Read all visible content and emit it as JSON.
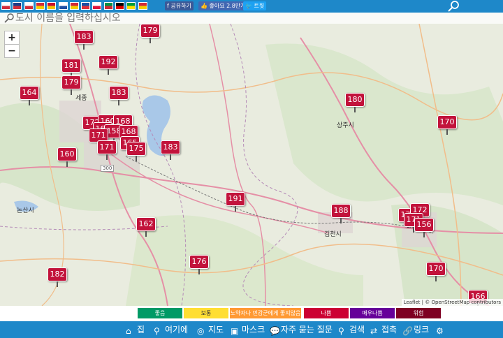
{
  "topbar": {
    "flags": [
      {
        "name": "flag-kr",
        "c1": "#ffffff",
        "c2": "#d12c3a"
      },
      {
        "name": "flag-uk",
        "c1": "#1d3c87",
        "c2": "#d12c3a"
      },
      {
        "name": "flag-jp",
        "c1": "#ffffff",
        "c2": "#d12c3a"
      },
      {
        "name": "flag-cn",
        "c1": "#d12c3a",
        "c2": "#f5d000"
      },
      {
        "name": "flag-es",
        "c1": "#c8102e",
        "c2": "#f5c400"
      },
      {
        "name": "flag-ru",
        "c1": "#ffffff",
        "c2": "#1d4fa3"
      },
      {
        "name": "flag-vn",
        "c1": "#d12c3a",
        "c2": "#f5d000"
      },
      {
        "name": "flag-fr",
        "c1": "#1d4fa3",
        "c2": "#e0303a"
      },
      {
        "name": "flag-pl",
        "c1": "#ffffff",
        "c2": "#dc143c"
      },
      {
        "name": "flag-it",
        "c1": "#009246",
        "c2": "#ce2b37"
      },
      {
        "name": "flag-de",
        "c1": "#000000",
        "c2": "#dd0000"
      },
      {
        "name": "flag-br",
        "c1": "#009c3b",
        "c2": "#ffdf00"
      },
      {
        "name": "flag-vn2",
        "c1": "#d12c3a",
        "c2": "#f5d000"
      }
    ],
    "share_label": "공유하기",
    "like_label": "좋아요 2.8만개",
    "tweet_label": "트윗"
  },
  "search": {
    "placeholder": "도시 이름을 입력하십시오"
  },
  "zoom": {
    "in": "+",
    "out": "−"
  },
  "markers": [
    {
      "v": "179"
    },
    {
      "v": "183"
    },
    {
      "v": "181"
    },
    {
      "v": "192"
    },
    {
      "v": "179"
    },
    {
      "v": "164"
    },
    {
      "v": "183"
    },
    {
      "v": "180"
    },
    {
      "v": "170"
    },
    {
      "v": "172"
    },
    {
      "v": "160"
    },
    {
      "v": "168"
    },
    {
      "v": "164"
    },
    {
      "v": "158"
    },
    {
      "v": "168"
    },
    {
      "v": "171"
    },
    {
      "v": "165"
    },
    {
      "v": "171"
    },
    {
      "v": "175"
    },
    {
      "v": "183"
    },
    {
      "v": "160"
    },
    {
      "v": "191"
    },
    {
      "v": "188"
    },
    {
      "v": "171"
    },
    {
      "v": "172"
    },
    {
      "v": "171"
    },
    {
      "v": "156"
    },
    {
      "v": "162"
    },
    {
      "v": "176"
    },
    {
      "v": "170"
    },
    {
      "v": "182"
    },
    {
      "v": "166"
    }
  ],
  "labels": {
    "sangju": "상주시",
    "gimcheon": "김천시",
    "nonsan": "논산시",
    "sejong": "세종",
    "road300": "300"
  },
  "attribution": "Leaflet | © OpenStreetMap contributors",
  "legend": [
    {
      "label": "좋음",
      "color": "#009a66"
    },
    {
      "label": "보통",
      "color": "#ffde33"
    },
    {
      "label": "노약자나 민감군에게 좋지않음",
      "color": "#ff9933"
    },
    {
      "label": "나쁨",
      "color": "#cc0033"
    },
    {
      "label": "매우나쁨",
      "color": "#660099"
    },
    {
      "label": "위험",
      "color": "#7e0023"
    }
  ],
  "nav": {
    "home": "집",
    "here": "여기에",
    "map": "지도",
    "mask": "마스크",
    "faq": "자주 묻는 질문",
    "search": "검색",
    "connect": "접촉",
    "link": "링크"
  }
}
